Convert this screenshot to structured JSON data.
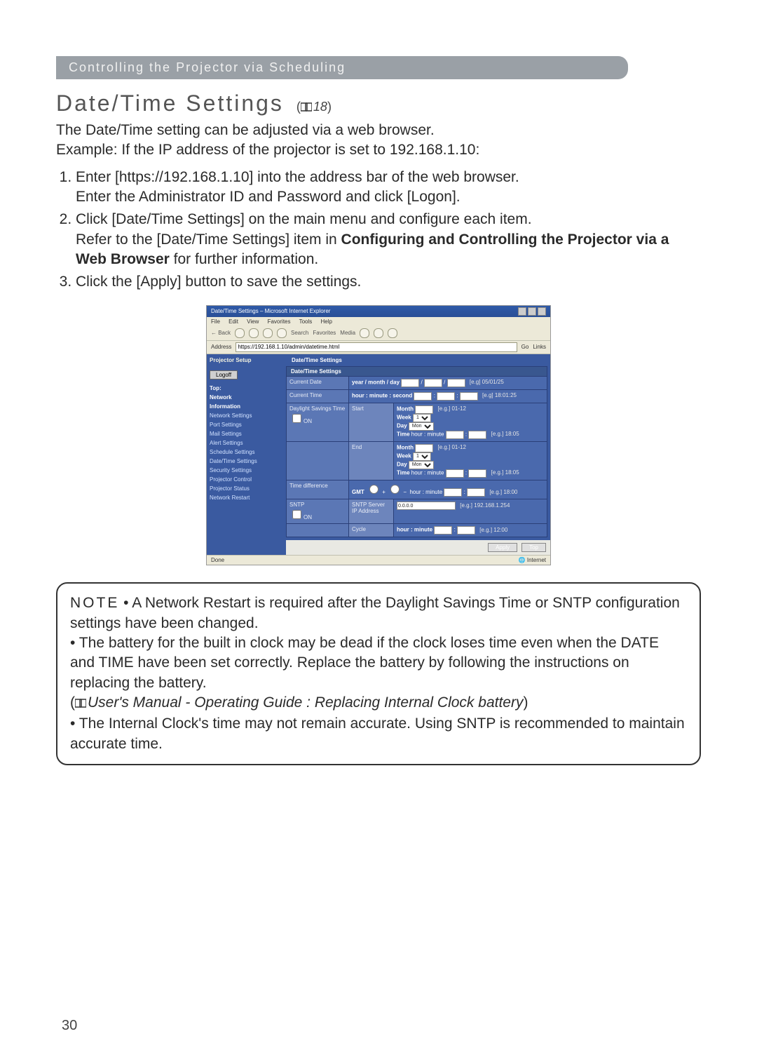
{
  "banner": "Controlling the Projector via Scheduling",
  "heading": "Date/Time Settings",
  "ref_page": "18",
  "intro_line1": "The Date/Time setting can be adjusted via a web browser.",
  "intro_line2": "Example: If the IP address of the projector is set to 192.168.1.10:",
  "steps": {
    "s1a": "Enter [https://192.168.1.10] into the address bar of the web browser.",
    "s1b": "Enter the Administrator ID and Password and click [Logon].",
    "s2a": "Click [Date/Time Settings] on the main menu and configure each item.",
    "s2b_pre": "Refer to the [Date/Time Settings] item in ",
    "s2b_bold": "Configuring and Controlling the Projector via a Web Browser",
    "s2b_post": " for further information.",
    "s3": "Click the [Apply] button to save the settings."
  },
  "shot": {
    "window_title": "Date/Time Settings – Microsoft Internet Explorer",
    "menu": {
      "file": "File",
      "edit": "Edit",
      "view": "View",
      "favorites": "Favorites",
      "tools": "Tools",
      "help": "Help"
    },
    "toolbar": {
      "back": "← Back",
      "search": "Search",
      "favorites": "Favorites",
      "media": "Media"
    },
    "addr_label": "Address",
    "addr_value": "https://192.168.1.10/admin/datetime.html",
    "go": "Go",
    "links": "Links",
    "brand": "Projector Setup",
    "logoff": "Logoff",
    "side": {
      "top1": "Top:",
      "top2": "Network",
      "top3": "Information",
      "network": "Network Settings",
      "port": "Port Settings",
      "mail": "Mail Settings",
      "alert": "Alert Settings",
      "schedule": "Schedule Settings",
      "datetime": "Date/Time Settings",
      "security": "Security Settings",
      "control": "Projector Control",
      "status": "Projector Status",
      "restart": "Network Restart"
    },
    "main_title": "Date/Time Settings",
    "panel_head": "Date/Time Settings",
    "labels": {
      "current_date": "Current Date",
      "current_time": "Current Time",
      "daylight": "Daylight Savings Time",
      "start": "Start",
      "end": "End",
      "timediff": "Time difference",
      "sntp": "SNTP",
      "sntp_ip": "SNTP Server IP Address",
      "cycle": "Cycle",
      "on": "ON"
    },
    "fields": {
      "date_text": "year / month / day",
      "date_eg": "[e.g] 05/01/25",
      "time_text": "hour : minute : second",
      "time_eg": "[e.g] 18:01:25",
      "month": "Month",
      "month_eg": "[e.g.] 01-12",
      "week": "Week",
      "day": "Day",
      "time": "Time",
      "time_hm": "hour : minute",
      "time_hm_eg": "[e.g.] 18:05",
      "gmt": "GMT",
      "gmt_hm": "hour : minute",
      "gmt_eg": "[e.g.] 18:00",
      "sntp_val": "0.0.0.0",
      "sntp_eg": "[e.g.] 192.168.1.254",
      "cycle_text": "hour : minute",
      "cycle_eg": "[e.g.] 12:00"
    },
    "opts": {
      "week1": "1",
      "daymon": "Mon"
    },
    "apply": "Apply",
    "top": "Top",
    "done": "Done",
    "internet": "Internet"
  },
  "note": {
    "label": "NOTE",
    "n1": " • A Network Restart is required after the Daylight Savings Time or SNTP configuration settings have been changed.",
    "n2": "• The battery for the built in clock may be dead if the clock loses time even when the DATE and TIME have been set correctly. Replace the battery by following the instructions on replacing the battery.",
    "n2_ref": "User's Manual - Operating Guide : Replacing Internal Clock battery",
    "n3": "• The Internal Clock's time may not remain accurate. Using SNTP is recommended to maintain accurate time."
  },
  "page_number": "30"
}
